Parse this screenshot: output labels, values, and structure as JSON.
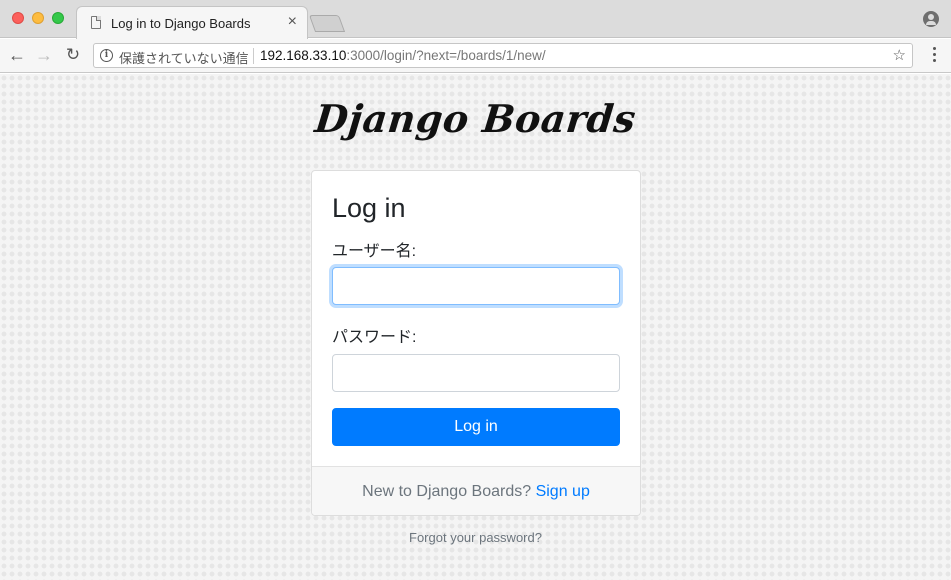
{
  "browser": {
    "tab_title": "Log in to Django Boards",
    "tab_close": "×",
    "security_label": "保護されていない通信",
    "url_host": "192.168.33.10",
    "url_rest": ":3000/login/?next=/boards/1/new/",
    "icons": {
      "back": "arrow-left-icon",
      "forward": "arrow-right-icon",
      "reload": "reload-icon",
      "info": "info-icon",
      "bookmark": "star-icon",
      "menu": "more-vertical-icon",
      "profile": "profile-icon",
      "page": "document-icon"
    }
  },
  "page": {
    "brand": "Django Boards",
    "card": {
      "title": "Log in",
      "username_label": "ユーザー名:",
      "username_value": "",
      "password_label": "パスワード:",
      "password_value": "",
      "submit_label": "Log in",
      "footer_text": "New to Django Boards?",
      "signup_link": "Sign up"
    },
    "forgot_link": "Forgot your password?"
  },
  "colors": {
    "primary": "#007bff",
    "text": "#212529",
    "muted": "#6c757d"
  }
}
